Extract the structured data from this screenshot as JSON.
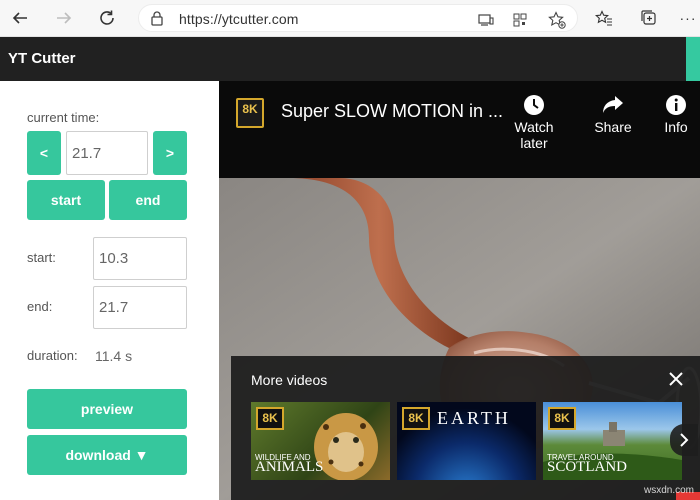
{
  "browser": {
    "url": "https://ytcutter.com",
    "icons": [
      "back-arrow-icon",
      "forward-arrow-icon",
      "reload-icon",
      "lock-icon",
      "app-available-icon",
      "qr-code-icon",
      "add-favorite-icon",
      "favorites-icon",
      "collections-icon",
      "more-menu-icon"
    ]
  },
  "app": {
    "title": "YT Cutter",
    "accent": "#36c79d"
  },
  "panel": {
    "current_time_label": "current time:",
    "prev_label": "<",
    "next_label": ">",
    "current_time_value": "21.7",
    "start_btn": "start",
    "end_btn": "end",
    "start_label": "start:",
    "start_value": "10.3",
    "end_label": "end:",
    "end_value": "21.7",
    "duration_label": "duration:",
    "duration_value": "11.4 s",
    "preview_btn": "preview",
    "download_btn": "download ▼"
  },
  "video": {
    "channel_badge": "8K",
    "title": "Super SLOW MOTION in ...",
    "actions": [
      {
        "label": "Watch later",
        "icon": "clock-icon"
      },
      {
        "label": "Share",
        "icon": "share-icon"
      },
      {
        "label": "Info",
        "icon": "info-icon"
      }
    ],
    "more_videos": {
      "title": "More videos",
      "thumbs": [
        {
          "badge": "8K",
          "line1": "WILDLIFE AND",
          "line2": "ANIMALS"
        },
        {
          "badge": "8K",
          "line1": "",
          "line2": "EARTH"
        },
        {
          "badge": "8K",
          "line1": "TRAVEL AROUND",
          "line2": "SCOTLAND"
        }
      ]
    },
    "watermark": "wsxdn.com"
  }
}
